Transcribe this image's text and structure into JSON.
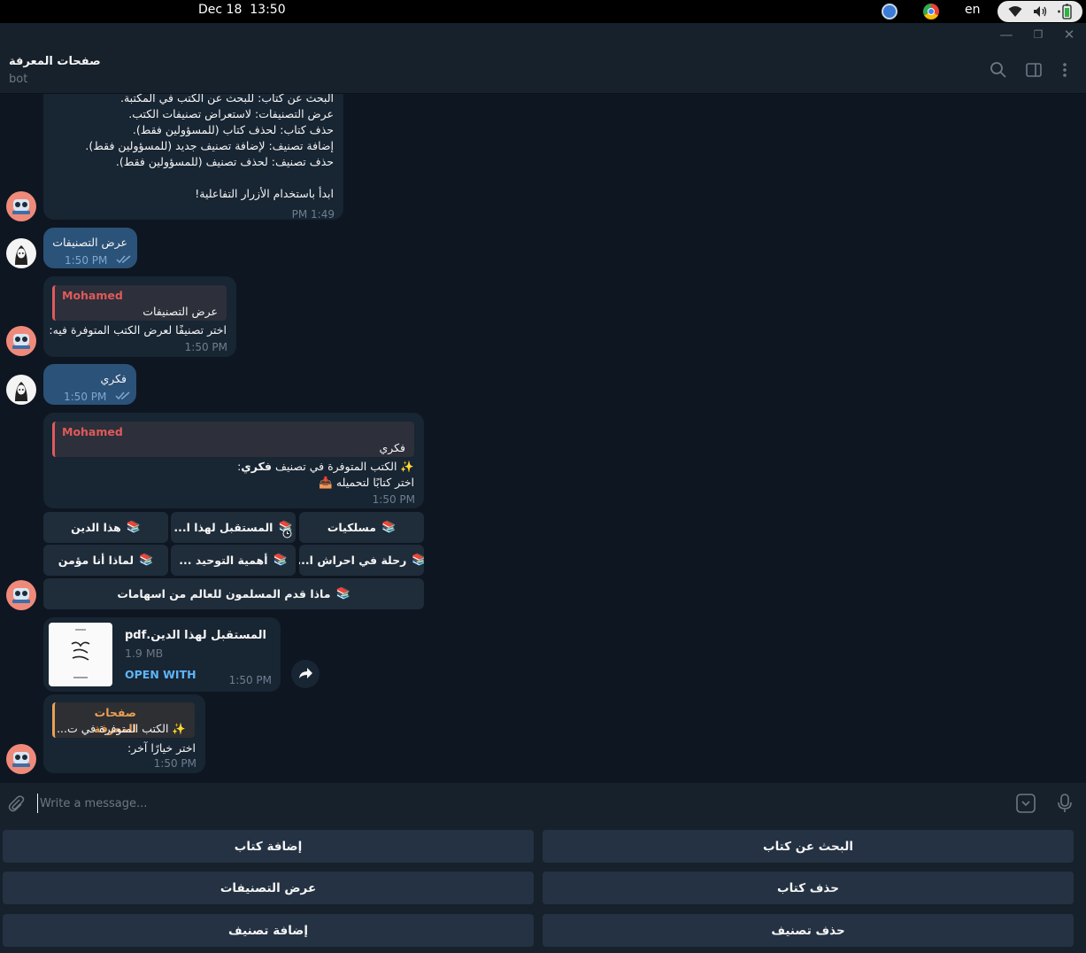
{
  "system": {
    "clock": "Dec 18  13:50",
    "lang": "en"
  },
  "header": {
    "title": "صفحات المعرفة",
    "subtitle": "bot"
  },
  "messages": {
    "intro_lines": [
      "البحث عن كتاب: للبحث عن الكتب في المكتبة.",
      "عرض التصنيفات: لاستعراض تصنيفات الكتب.",
      "حذف كتاب: لحذف كتاب (للمسؤولين فقط).",
      "إضافة تصنيف: لإضافة تصنيف جديد (للمسؤولين فقط).",
      "حذف تصنيف: لحذف تصنيف (للمسؤولين فقط).",
      "",
      "ابدأ باستخدام الأزرار التفاعلية!"
    ],
    "intro_time": "1:49 PM",
    "out1_text": "عرض التصنيفات",
    "out1_time": "1:50 PM",
    "in2_reply_name": "Mohamed",
    "in2_reply_text": "عرض التصنيفات",
    "in2_text": "اختر تصنيفًا لعرض الكتب المتوفرة فيه:",
    "in2_time": "1:50 PM",
    "out2_text": "فكري",
    "out2_time": "1:50 PM",
    "in3_reply_name": "Mohamed",
    "in3_reply_text": "فكري",
    "in3_line1_prefix": "✨ الكتب المتوفرة في تصنيف ",
    "in3_line1_bold": "فكري",
    "in3_line1_suffix": ":",
    "in3_line2": "اختر كتابًا لتحميله 📥",
    "in3_time": "1:50 PM",
    "inline_buttons": [
      "مسلكيات",
      "المستقبل لهذا ا...",
      "هذا الدين",
      "رحلة في احراش ا...",
      "أهمية التوحيد ...",
      "لماذا أنا مؤمن",
      "ماذا قدم المسلمون للعالم من اسهامات"
    ],
    "book_icon": "📚",
    "file_name": "المستقبل لهذا الدين.pdf",
    "file_size": "1.9 MB",
    "file_open": "OPEN WITH",
    "file_time": "1:50 PM",
    "in4_reply_name": "صفحات المعرفة",
    "in4_reply_text": "✨ الكتب المتوفرة في ت...",
    "in4_text": "اختر خيارًا آخر:",
    "in4_time": "1:50 PM"
  },
  "composer": {
    "placeholder": "Write a message..."
  },
  "keyboard": {
    "search_book": "البحث عن كتاب",
    "add_book": "إضافة كتاب",
    "delete_book": "حذف كتاب",
    "show_categories": "عرض التصنيفات",
    "delete_category": "حذف تصنيف",
    "add_category": "إضافة تصنيف"
  },
  "colors": {
    "background": "#0e1621",
    "incoming_bubble": "#182533",
    "outgoing_bubble": "#2b5278",
    "accent": "#5eb5f7",
    "reply_red": "#e05a5a",
    "reply_orange": "#e9a055"
  }
}
